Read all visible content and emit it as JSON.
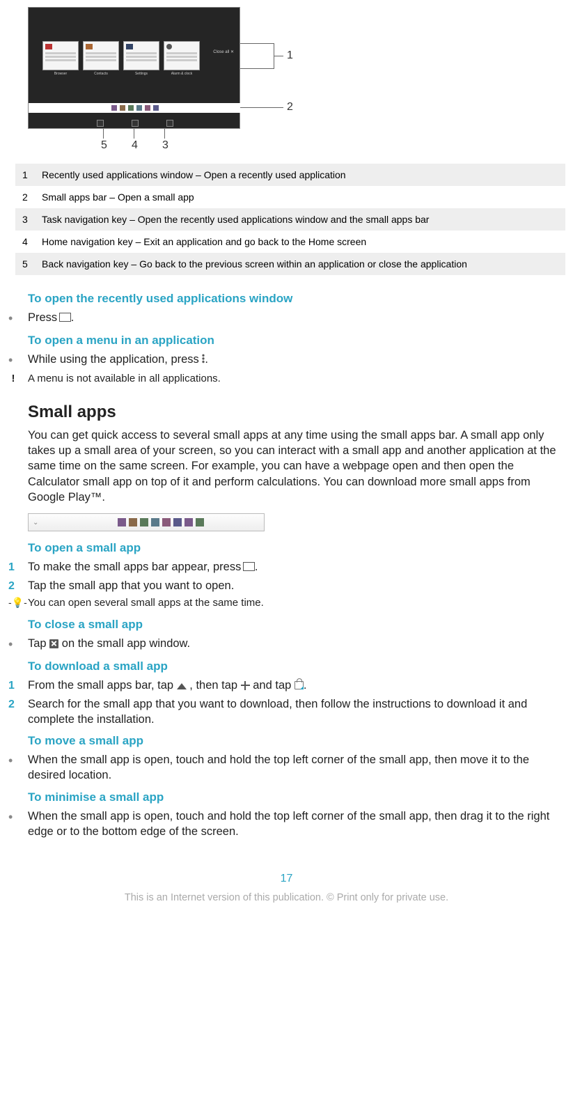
{
  "legend": [
    {
      "num": "1",
      "text": "Recently used applications window – Open a recently used application"
    },
    {
      "num": "2",
      "text": "Small apps bar – Open a small app"
    },
    {
      "num": "3",
      "text": "Task navigation key – Open the recently used applications window and the small apps bar"
    },
    {
      "num": "4",
      "text": "Home navigation key – Exit an application and go back to the Home screen"
    },
    {
      "num": "5",
      "text": "Back navigation key – Go back to the previous screen within an application or close the application"
    }
  ],
  "diagram": {
    "callouts": {
      "c1": "1",
      "c2": "2",
      "c3": "3",
      "c4": "4",
      "c5": "5"
    },
    "tiles": [
      "Browser",
      "Contacts",
      "Settings",
      "Alarm & clock"
    ],
    "closeall": "Close all ✕"
  },
  "s1": {
    "h": "To open the recently used applications window",
    "b1a": "Press ",
    "b1b": "."
  },
  "s2": {
    "h": "To open a menu in an application",
    "b1a": "While using the application, press ",
    "b1b": ".",
    "note": "A menu is not available in all applications."
  },
  "smallapps": {
    "h": "Small apps",
    "p": "You can get quick access to several small apps at any time using the small apps bar. A small app only takes up a small area of your screen, so you can interact with a small app and another application at the same time on the same screen. For example, you can have a webpage open and then open the Calculator small app on top of it and perform calculations. You can download more small apps from Google Play™."
  },
  "s3": {
    "h": "To open a small app",
    "n1a": "To make the small apps bar appear, press ",
    "n1b": ".",
    "n2": "Tap the small app that you want to open.",
    "tip": "You can open several small apps at the same time."
  },
  "s4": {
    "h": "To close a small app",
    "b1a": "Tap ",
    "b1b": " on the small app window."
  },
  "s5": {
    "h": "To download a small app",
    "n1a": "From the small apps bar, tap ",
    "n1b": " , then tap ",
    "n1c": " and tap ",
    "n1d": ".",
    "n2": "Search for the small app that you want to download, then follow the instructions to download it and complete the installation."
  },
  "s6": {
    "h": "To move a small app",
    "b1": "When the small app is open, touch and hold the top left corner of the small app, then move it to the desired location."
  },
  "s7": {
    "h": "To minimise a small app",
    "b1": "When the small app is open, touch and hold the top left corner of the small app, then drag it to the right edge or to the bottom edge of the screen."
  },
  "pagenum": "17",
  "footer": "This is an Internet version of this publication. © Print only for private use."
}
